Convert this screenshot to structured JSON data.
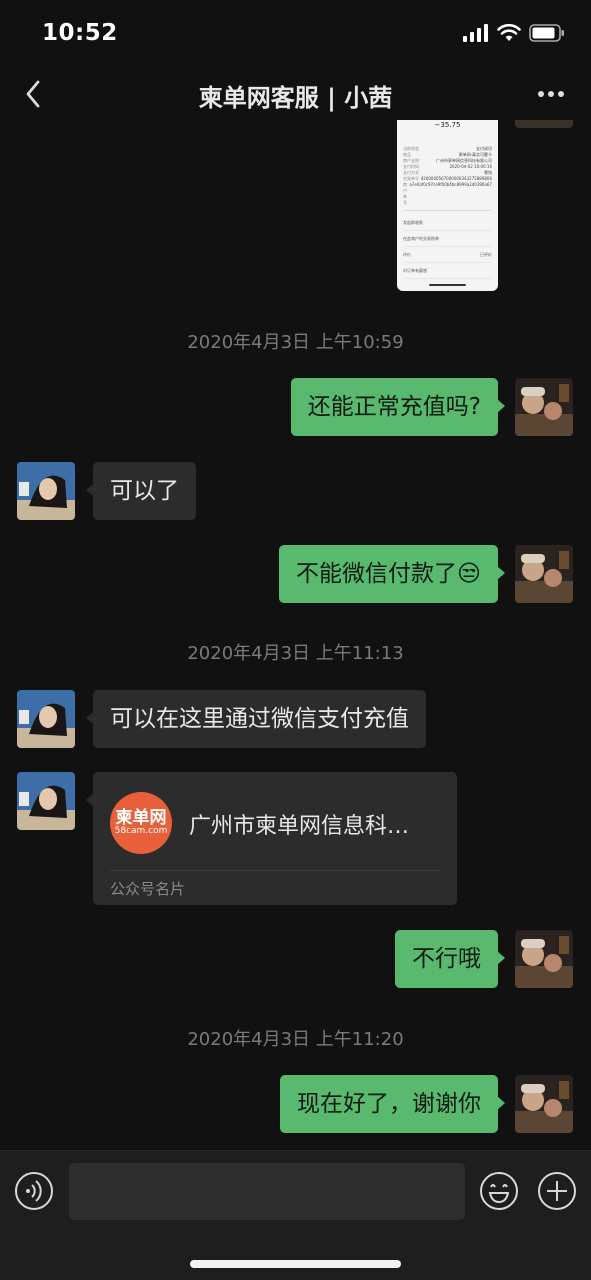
{
  "status_bar": {
    "time": "10:52"
  },
  "header": {
    "title": "柬单网客服 | 小茜"
  },
  "receipt_preview": {
    "amount": "−35.75",
    "rows": [
      [
        "当前状态",
        "支付成功"
      ],
      [
        "商品",
        "柬单网·真实可靠卡"
      ],
      [
        "商户全称",
        "广州市柬单网信息科技有限公司"
      ],
      [
        "支付时间",
        "2020-04-02 16:00:16"
      ],
      [
        "支付方式",
        "零钱"
      ],
      [
        "交易单号",
        "4200000567000000343275889806"
      ],
      [
        "商户单号",
        "a7e0af0c97ce9f00b4bc8999a2d0396a67"
      ]
    ],
    "links": [
      [
        "发起群收款",
        ""
      ],
      [
        "在此商户的交易账单",
        ""
      ],
      [
        "评价",
        "已评价"
      ],
      [
        "对订单有疑惑",
        ""
      ]
    ]
  },
  "chat": {
    "timestamps": [
      "2020年4月3日 上午10:59",
      "2020年4月3日 上午11:13",
      "2020年4月3日 上午11:20"
    ],
    "messages": [
      {
        "text": "还能正常充值吗?"
      },
      {
        "text": "可以了"
      },
      {
        "text": "不能微信付款了",
        "emoji": "😒"
      },
      {
        "text": "可以在这里通过微信支付充值"
      },
      {
        "text": "不行哦"
      },
      {
        "text": "现在好了，谢谢你"
      }
    ],
    "card": {
      "logo_text": "柬单网",
      "logo_sub": "58cam.com",
      "name": "广州市柬单网信息科…",
      "type": "公众号名片"
    }
  },
  "colors": {
    "background": "#111111",
    "bubble_out": "#58b96f",
    "bubble_in": "#2c2c2c",
    "logo": "#e8603a"
  },
  "icons": [
    "back-icon",
    "more-icon",
    "voice-icon",
    "emoji-icon",
    "plus-icon",
    "signal-icon",
    "wifi-icon",
    "battery-icon"
  ]
}
